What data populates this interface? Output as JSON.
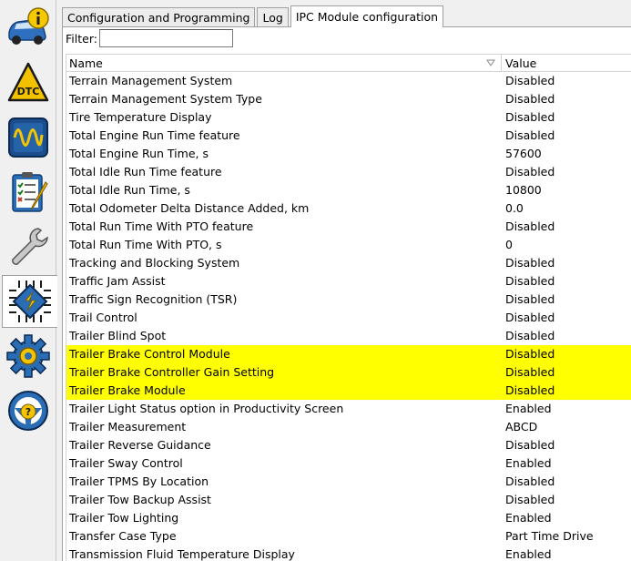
{
  "sidebar": {
    "items": [
      {
        "icon": "vehicle-info-icon"
      },
      {
        "icon": "dtc-icon"
      },
      {
        "icon": "oscilloscope-icon"
      },
      {
        "icon": "checklist-icon"
      },
      {
        "icon": "wrench-icon"
      },
      {
        "icon": "module-chip-icon",
        "active": true
      },
      {
        "icon": "settings-gear-icon"
      },
      {
        "icon": "steering-help-icon"
      }
    ]
  },
  "tabs": [
    {
      "label": "Configuration and Programming",
      "active": false
    },
    {
      "label": "Log",
      "active": false
    },
    {
      "label": "IPC Module configuration",
      "active": true
    }
  ],
  "filter": {
    "label": "Filter:",
    "value": ""
  },
  "table": {
    "headers": {
      "name": "Name",
      "value": "Value"
    },
    "rows": [
      {
        "name": "Terrain Management System",
        "value": "Disabled",
        "highlighted": false
      },
      {
        "name": "Terrain Management System Type",
        "value": "Disabled",
        "highlighted": false
      },
      {
        "name": "Tire Temperature Display",
        "value": "Disabled",
        "highlighted": false
      },
      {
        "name": "Total Engine Run Time feature",
        "value": "Disabled",
        "highlighted": false
      },
      {
        "name": "Total Engine Run Time, s",
        "value": "57600",
        "highlighted": false
      },
      {
        "name": "Total Idle Run Time feature",
        "value": "Disabled",
        "highlighted": false
      },
      {
        "name": "Total Idle Run Time, s",
        "value": "10800",
        "highlighted": false
      },
      {
        "name": "Total Odometer Delta Distance Added, km",
        "value": "0.0",
        "highlighted": false
      },
      {
        "name": "Total Run Time With PTO feature",
        "value": "Disabled",
        "highlighted": false
      },
      {
        "name": "Total Run Time With PTO, s",
        "value": "0",
        "highlighted": false
      },
      {
        "name": "Tracking and Blocking System",
        "value": "Disabled",
        "highlighted": false
      },
      {
        "name": "Traffic Jam Assist",
        "value": "Disabled",
        "highlighted": false
      },
      {
        "name": "Traffic Sign Recognition (TSR)",
        "value": "Disabled",
        "highlighted": false
      },
      {
        "name": "Trail Control",
        "value": "Disabled",
        "highlighted": false
      },
      {
        "name": "Trailer Blind Spot",
        "value": "Disabled",
        "highlighted": false
      },
      {
        "name": "Trailer Brake Control Module",
        "value": "Disabled",
        "highlighted": true
      },
      {
        "name": "Trailer Brake Controller Gain Setting",
        "value": "Disabled",
        "highlighted": true
      },
      {
        "name": "Trailer Brake Module",
        "value": "Disabled",
        "highlighted": true
      },
      {
        "name": "Trailer Light Status option in Productivity Screen",
        "value": "Enabled",
        "highlighted": false
      },
      {
        "name": "Trailer Measurement",
        "value": "ABCD",
        "highlighted": false
      },
      {
        "name": "Trailer Reverse Guidance",
        "value": "Disabled",
        "highlighted": false
      },
      {
        "name": "Trailer Sway Control",
        "value": "Enabled",
        "highlighted": false
      },
      {
        "name": "Trailer TPMS By Location",
        "value": "Disabled",
        "highlighted": false
      },
      {
        "name": "Trailer Tow Backup Assist",
        "value": "Disabled",
        "highlighted": false
      },
      {
        "name": "Trailer Tow Lighting",
        "value": "Enabled",
        "highlighted": false
      },
      {
        "name": "Transfer Case Type",
        "value": "Part Time Drive",
        "highlighted": false
      },
      {
        "name": "Transmission Fluid Temperature Display",
        "value": "Enabled",
        "highlighted": false
      }
    ]
  },
  "colors": {
    "highlight": "#ffff00"
  }
}
